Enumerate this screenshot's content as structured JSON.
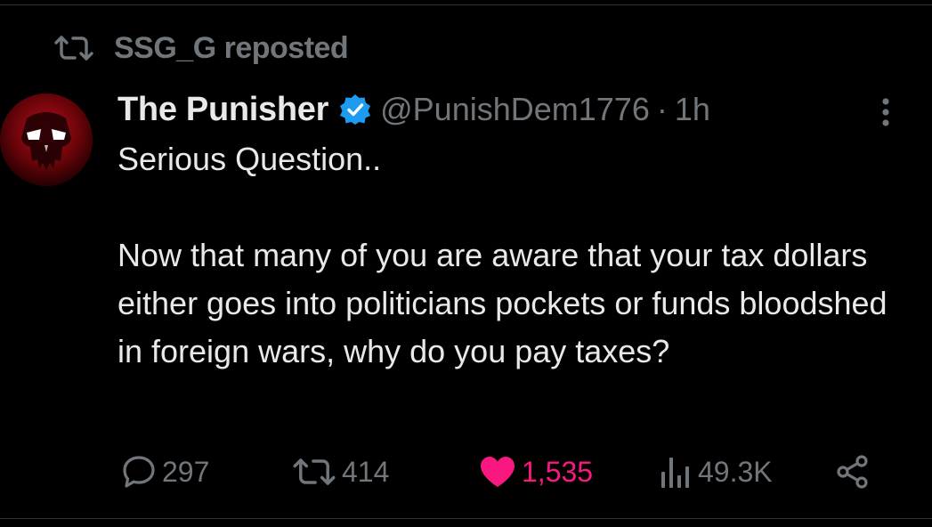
{
  "repost_banner": {
    "label": "SSG_G reposted",
    "icon": "repost-icon"
  },
  "tweet": {
    "author_name": "The Punisher",
    "verified": true,
    "handle": "@PunishDem1776",
    "separator": "·",
    "time": "1h",
    "paragraph_1": "Serious Question..",
    "paragraph_2": "Now that many of you are aware that your tax dollars either goes into politicians pockets or funds bloodshed in foreign wars, why do you pay taxes?"
  },
  "actions": {
    "replies": "297",
    "reposts": "414",
    "likes": "1,535",
    "views": "49.3K"
  },
  "colors": {
    "background": "#000000",
    "text_primary": "#e7e9ea",
    "text_secondary": "#71767b",
    "verified_blue": "#1d9bf0",
    "like_pink": "#f91880"
  }
}
